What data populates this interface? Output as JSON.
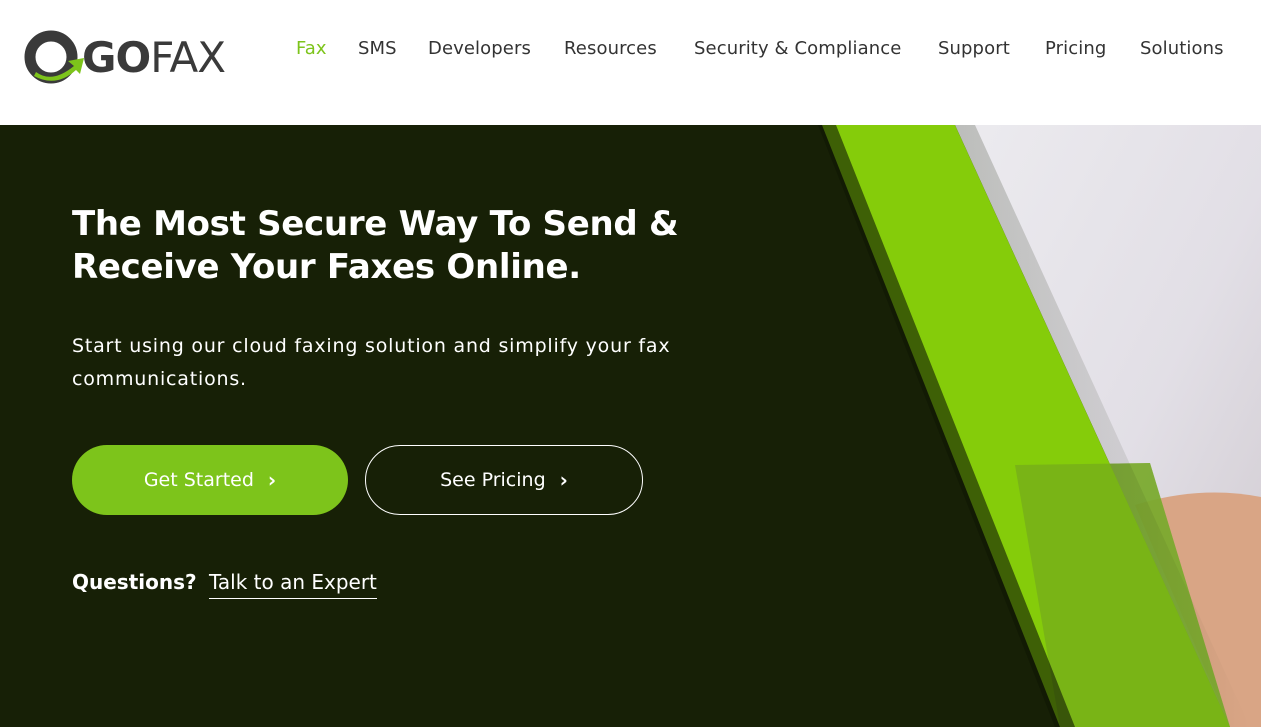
{
  "brand": {
    "logo_go": "GO",
    "logo_fax": "FAX",
    "accent": "#7dc41b",
    "dark": "#172006"
  },
  "nav": {
    "items": [
      {
        "label": "Fax",
        "active": true
      },
      {
        "label": "SMS"
      },
      {
        "label": "Developers"
      },
      {
        "label": "Resources"
      },
      {
        "label": "Security & Compliance"
      },
      {
        "label": "Support"
      },
      {
        "label": "Pricing"
      },
      {
        "label": "Solutions"
      }
    ]
  },
  "hero": {
    "title": "The Most Secure Way To Send & Receive Your Faxes Online.",
    "subtitle": "Start using our cloud faxing solution and simplify your fax communications.",
    "primary_button": "Get Started",
    "secondary_button": "See Pricing",
    "button_icon": "chevron-right-icon",
    "questions_label": "Questions?",
    "questions_link": "Talk to an Expert"
  }
}
